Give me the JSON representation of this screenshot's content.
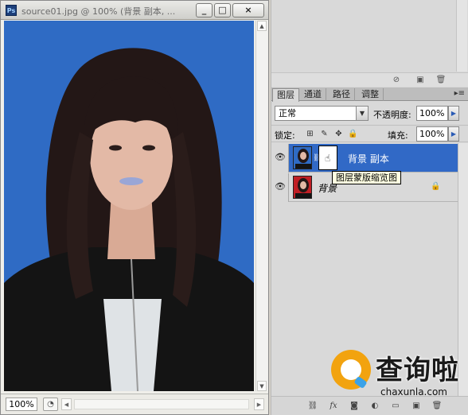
{
  "document_window": {
    "title": "source01.jpg @ 100% (背景 副本, ...",
    "app_icon": "Ps",
    "buttons": {
      "minimize": "_",
      "maximize": "□",
      "close": "×"
    },
    "zoom": "100%"
  },
  "layers_panel": {
    "tabs": [
      {
        "label": "图层",
        "active": true
      },
      {
        "label": "通道",
        "active": false
      },
      {
        "label": "路径",
        "active": false
      },
      {
        "label": "调整",
        "active": false
      }
    ],
    "menu_icon": "▸≡",
    "blend_mode": "正常",
    "opacity_label": "不透明度:",
    "opacity_value": "100%",
    "lock_label": "锁定:",
    "fill_label": "填充:",
    "fill_value": "100%",
    "layers": [
      {
        "name": "背景 副本",
        "selected": true,
        "has_mask": true,
        "visible": true
      },
      {
        "name": "背景",
        "selected": false,
        "has_mask": false,
        "visible": true,
        "locked": true
      }
    ]
  },
  "tooltip": "图层蒙版缩览图",
  "watermark": {
    "brand": "查询啦",
    "url": "chaxunla.com"
  },
  "colors": {
    "canvas_bg": "#2f6bc4",
    "selection": "#3169c6",
    "tooltip_bg": "#ffffe1"
  }
}
